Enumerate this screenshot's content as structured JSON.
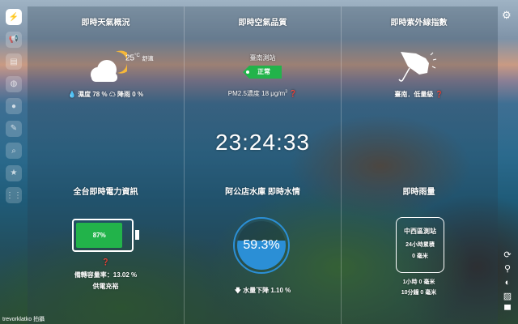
{
  "sidebar": {
    "items": [
      {
        "icon": "lightning-icon",
        "glyph": "⚡",
        "active": true
      },
      {
        "icon": "megaphone-icon",
        "glyph": "📢"
      },
      {
        "icon": "film-icon",
        "glyph": "▤"
      },
      {
        "icon": "globe-icon",
        "glyph": "◍"
      },
      {
        "icon": "chat-icon",
        "glyph": "●"
      },
      {
        "icon": "edit-icon",
        "glyph": "✎"
      },
      {
        "icon": "search-icon",
        "glyph": "⌕"
      },
      {
        "icon": "star-icon",
        "glyph": "★"
      },
      {
        "icon": "grid-icon",
        "glyph": "⋮⋮"
      }
    ]
  },
  "weather": {
    "title": "即時天氣概況",
    "temp": "25",
    "unit": "°C",
    "desc": "舒適",
    "humidity": "濕度 78 %",
    "rain": "降雨 0 %"
  },
  "air": {
    "title": "即時空氣品質",
    "station": "臺南測站",
    "status": "正常",
    "status_color": "#22b34a",
    "pm25": "PM2.5濃度 18 μg/m",
    "sup": "3"
  },
  "uv": {
    "title": "即時紫外線指數",
    "text": "臺南．低量級"
  },
  "clock": {
    "time": "23:24:33"
  },
  "power": {
    "title": "全台即時電力資訊",
    "percent": "87%",
    "fill": 0.87,
    "reserve": "備轉容量率：13.02 %",
    "status": "供電充裕"
  },
  "reservoir": {
    "title": "阿公店水庫 即時水情",
    "percent": "59.3%",
    "fill": 0.593,
    "change": "水量下降 1.10 %"
  },
  "rain": {
    "title": "即時雨量",
    "station": "中西區測站",
    "label24": "24小時累積",
    "value24": "0 毫米",
    "hour1": "1小時 0 毫米",
    "min10": "10分鐘 0 毫米"
  },
  "credit": "trevorklatko 拍攝",
  "right_icons": [
    "refresh-icon",
    "location-pin-icon",
    "contrast-icon",
    "image-icon",
    "comment-icon"
  ]
}
